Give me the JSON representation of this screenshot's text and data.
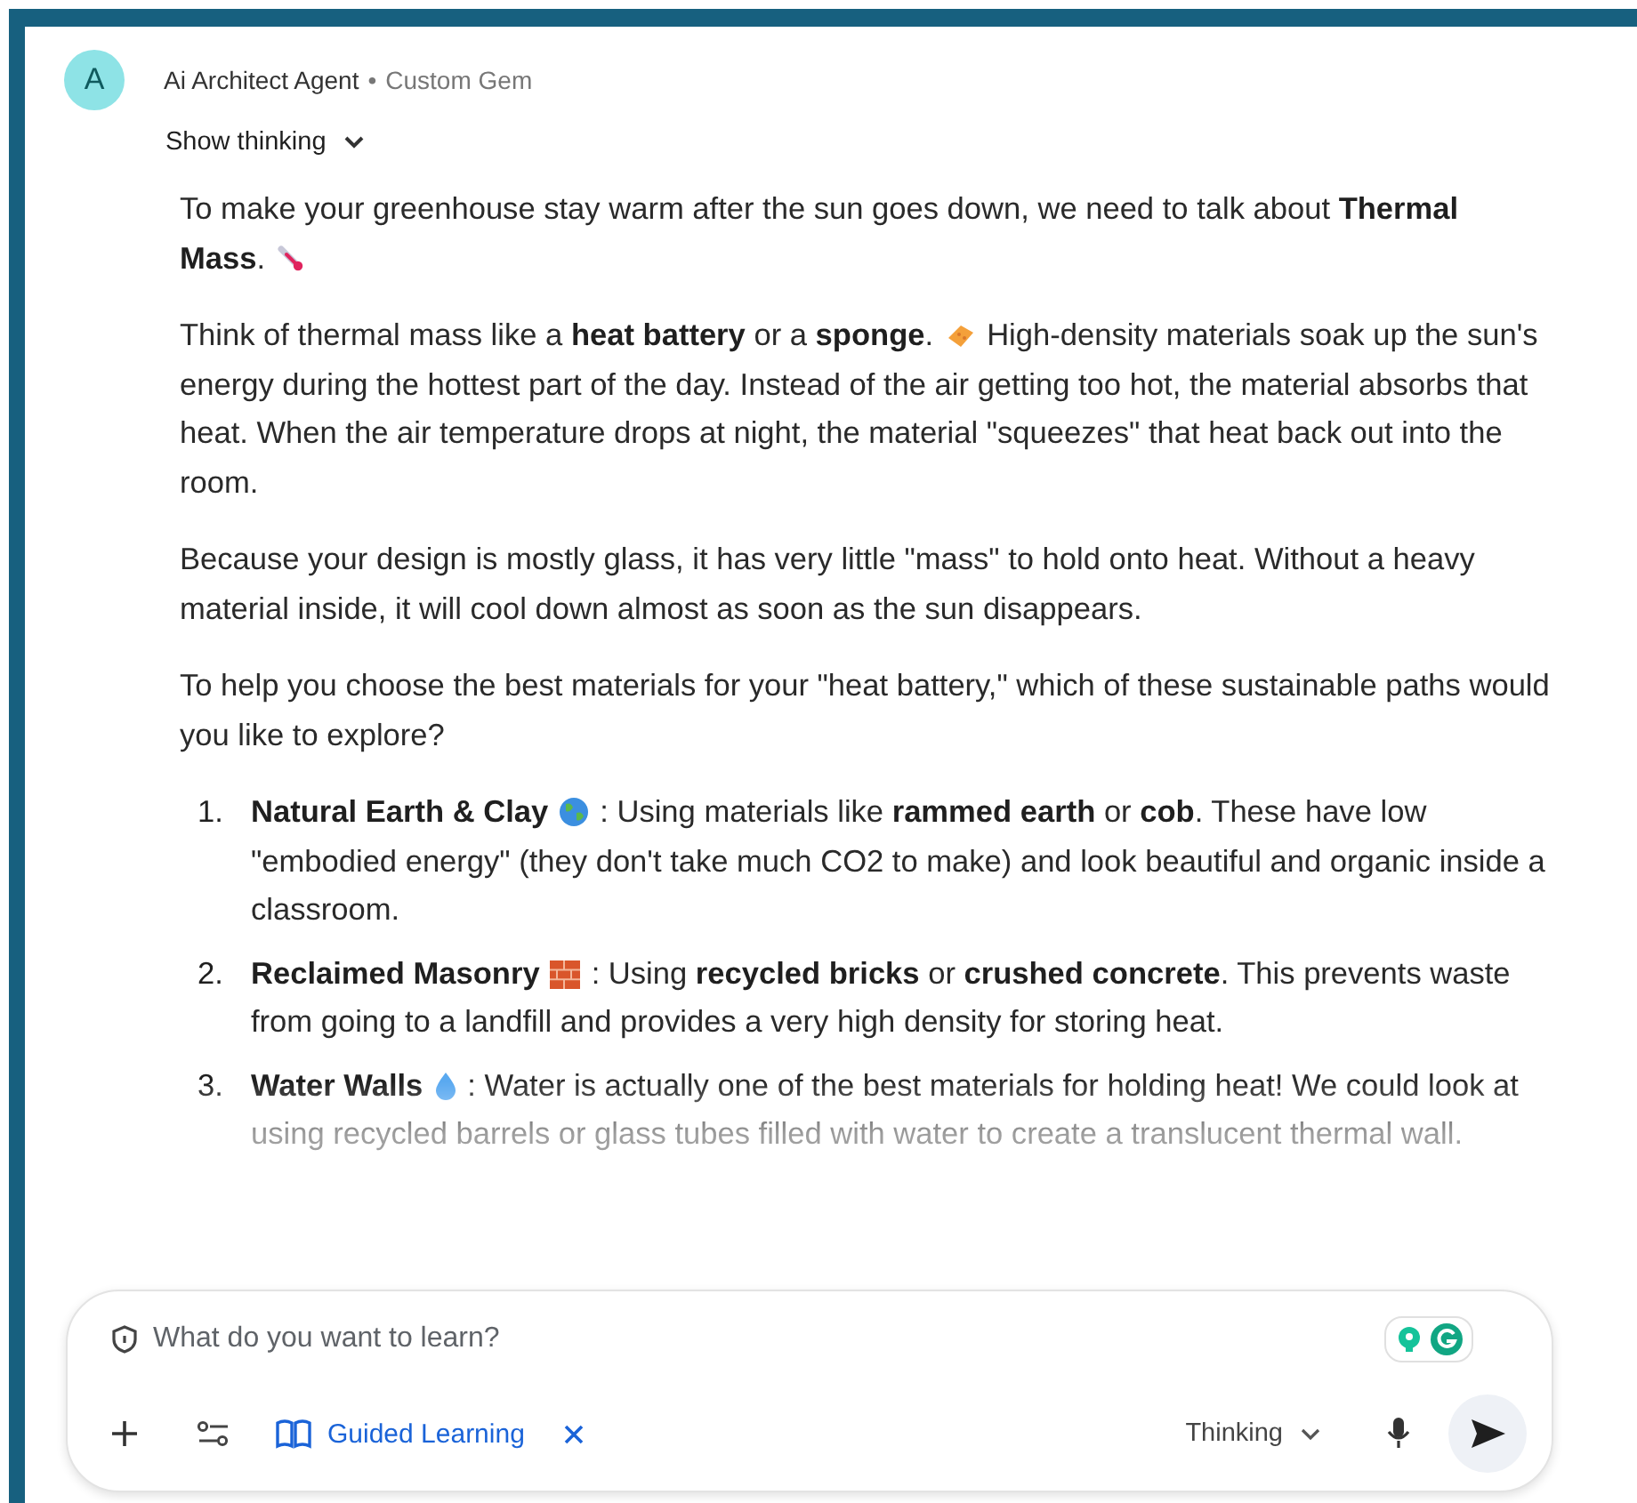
{
  "header": {
    "avatar": "A",
    "name": "Ai Architect Agent",
    "separator": "•",
    "subtitle": "Custom Gem"
  },
  "thinking_toggle": {
    "label": "Show thinking",
    "expanded": false
  },
  "paragraphs": [
    {
      "parts": [
        {
          "text": "To make your greenhouse stay warm after the sun goes down, we need to talk about **Thermal Mass**."
        },
        {
          "kind": "emoji"
        }
      ]
    },
    {
      "parts": [
        {
          "text": "Think of thermal mass like a **heat battery** or a **sponge**."
        },
        {
          "kind": "emoji"
        },
        {
          "text": "High-density materials soak up the sun's energy during the hottest part of the day. Instead of the air getting too hot, the material absorbs that heat. When the air temperature drops at night, the material \"squeezes\" that heat back out into the room."
        }
      ]
    },
    {
      "parts": [
        {
          "text": "Because your design is mostly glass, it has very little \"mass\" to hold onto heat. Without a heavy material inside, it will cool down almost as soon as the sun disappears."
        }
      ]
    },
    {
      "parts": [
        {
          "text": "To help you choose the best materials for your \"heat battery,\" which of these sustainable paths would you like to explore?"
        }
      ]
    }
  ],
  "options": [
    {
      "number": "1.",
      "parts": [
        {
          "text": "**Natural Earth & Clay**"
        },
        {
          "kind": "emoji"
        },
        {
          "text": ": Using materials like **rammed earth** or **cob**. These have low \"embodied energy\" (they don't take much CO2 to make) and look beautiful and organic inside a classroom."
        }
      ]
    },
    {
      "number": "2.",
      "parts": [
        {
          "text": "**Reclaimed Masonry**"
        },
        {
          "kind": "emoji"
        },
        {
          "text": ": Using **recycled bricks** or **crushed concrete**. This prevents waste from going to a landfill and provides a very high density for storing heat."
        }
      ]
    },
    {
      "number": "3.",
      "parts": [
        {
          "text": "**Water Walls**"
        },
        {
          "kind": "emoji"
        },
        {
          "text": ": Water is actually one of the best materials for holding heat! We could look at using recycled barrels or glass tubes filled with water to create a translucent thermal wall."
        }
      ]
    }
  ],
  "composer": {
    "placeholder": "What do you want to learn?",
    "tool_chip": "Guided Learning",
    "mode": "Thinking"
  }
}
